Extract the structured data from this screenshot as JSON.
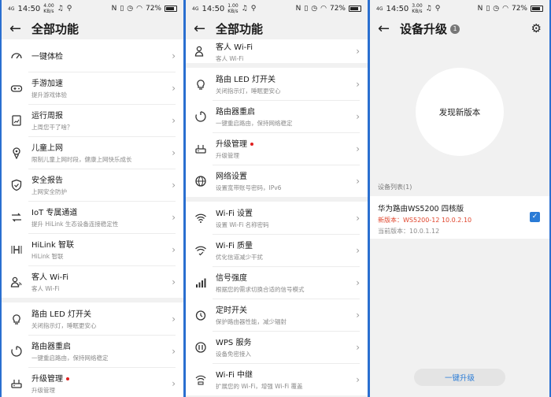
{
  "status": {
    "time": "14:50",
    "speed1": "4.00",
    "unit1": "KB/s",
    "speed2": "1.00",
    "unit2": "KB/s",
    "speed3": "3.00",
    "unit3": "KB/s",
    "battery": "72%",
    "signal": "4G",
    "nfc": "N"
  },
  "s1": {
    "title": "全部功能",
    "items": [
      {
        "title": "一键体检",
        "sub": "",
        "icon": "gauge-icon"
      },
      {
        "title": "手游加速",
        "sub": "提升游戏体验",
        "icon": "gamepad-icon"
      },
      {
        "title": "运行周报",
        "sub": "上周您干了啥？",
        "icon": "report-icon"
      },
      {
        "title": "儿童上网",
        "sub": "限制儿童上网时段，健康上网快乐成长",
        "icon": "child-icon"
      },
      {
        "title": "安全报告",
        "sub": "上网安全防护",
        "icon": "shield-icon"
      },
      {
        "title": "IoT 专属通道",
        "sub": "提升 HiLink 生态设备连接稳定性",
        "icon": "iot-icon"
      },
      {
        "title": "HiLink 智联",
        "sub": "HiLink 智联",
        "icon": "hilink-icon"
      },
      {
        "title": "客人 Wi-Fi",
        "sub": "客人 Wi-Fi",
        "icon": "guest-icon"
      }
    ],
    "items2": [
      {
        "title": "路由 LED 灯开关",
        "sub": "关闭指示灯，睡眠更安心",
        "icon": "bulb-icon"
      },
      {
        "title": "路由器重启",
        "sub": "一键重启路由，保持网络稳定",
        "icon": "restart-icon"
      },
      {
        "title": "升级管理",
        "sub": "升级管理",
        "icon": "router-icon"
      }
    ]
  },
  "s2": {
    "title": "全部功能",
    "items": [
      {
        "title": "客人 Wi-Fi",
        "sub": "客人 Wi-Fi",
        "icon": "guest-icon"
      }
    ],
    "items2": [
      {
        "title": "路由 LED 灯开关",
        "sub": "关闭指示灯，睡眠更安心",
        "icon": "bulb-icon"
      },
      {
        "title": "路由器重启",
        "sub": "一键重启路由，保持网络稳定",
        "icon": "restart-icon"
      },
      {
        "title": "升级管理",
        "sub": "升级管理",
        "icon": "router-icon"
      },
      {
        "title": "网络设置",
        "sub": "设置宽带账号密码，IPv6",
        "icon": "globe-icon"
      }
    ],
    "items3": [
      {
        "title": "Wi-Fi 设置",
        "sub": "设置 Wi-Fi 名称密码",
        "icon": "wifi-icon"
      },
      {
        "title": "Wi-Fi 质量",
        "sub": "优化信道减少干扰",
        "icon": "wifi-quality-icon"
      },
      {
        "title": "信号强度",
        "sub": "根据您的需求切换合适的信号模式",
        "icon": "signal-icon"
      },
      {
        "title": "定时开关",
        "sub": "保护路由器性能，减少辐射",
        "icon": "timer-icon"
      },
      {
        "title": "WPS 服务",
        "sub": "设备免密接入",
        "icon": "wps-icon"
      },
      {
        "title": "Wi-Fi 中继",
        "sub": "扩展您的 Wi-Fi，增强 Wi-Fi 覆盖",
        "icon": "relay-icon"
      }
    ]
  },
  "s3": {
    "title": "设备升级",
    "badge": "1",
    "circle": "发现新版本",
    "device_list_label": "设备列表(1)",
    "device_name": "华为路由WS5200 四核版",
    "new_version": "新版本：WS5200-12 10.0.2.10",
    "current_version": "当前版本：10.0.1.12",
    "upgrade_button": "一键升级"
  },
  "colors": {
    "accent": "#2a7bd6",
    "new_version": "#e0452c",
    "frame": "#2a6fd0"
  }
}
